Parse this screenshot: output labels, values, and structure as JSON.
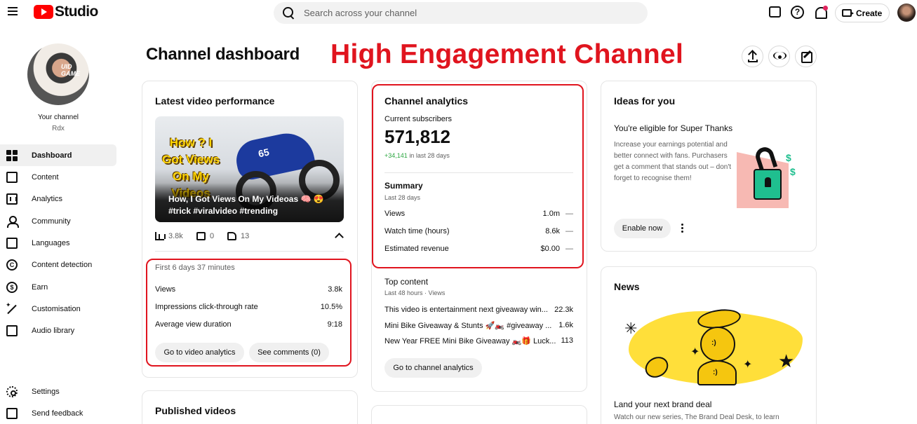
{
  "header": {
    "logo_text": "Studio",
    "search_placeholder": "Search across your channel",
    "create_label": "Create"
  },
  "annotation": {
    "text": "High Engagement Channel",
    "color": "#e0141e"
  },
  "sidebar": {
    "avatar_overlay": "UID GAME",
    "channel_label": "Your channel",
    "channel_name": "Rdx",
    "items": [
      {
        "label": "Dashboard",
        "icon": "dashboard-icon",
        "active": true
      },
      {
        "label": "Content",
        "icon": "content-icon"
      },
      {
        "label": "Analytics",
        "icon": "analytics-icon"
      },
      {
        "label": "Community",
        "icon": "community-icon"
      },
      {
        "label": "Languages",
        "icon": "languages-icon"
      },
      {
        "label": "Content detection",
        "icon": "copyright-icon"
      },
      {
        "label": "Earn",
        "icon": "dollar-icon"
      },
      {
        "label": "Customisation",
        "icon": "wand-icon"
      },
      {
        "label": "Audio library",
        "icon": "audio-library-icon"
      }
    ],
    "bottom": [
      {
        "label": "Settings",
        "icon": "gear-icon"
      },
      {
        "label": "Send feedback",
        "icon": "feedback-icon"
      }
    ]
  },
  "main": {
    "title": "Channel dashboard"
  },
  "latest_video": {
    "title": "Latest video performance",
    "thumbnail_overlay": "How ? I Got Views On My Videos",
    "bike_number": "65",
    "video_title": "How, I Got Views On My Videoas 🧠 😍 #trick #viralvideo #trending",
    "views": "3.8k",
    "comments": "0",
    "likes": "13",
    "period": "First 6 days 37 minutes",
    "metrics": [
      {
        "label": "Views",
        "value": "3.8k"
      },
      {
        "label": "Impressions click-through rate",
        "value": "10.5%"
      },
      {
        "label": "Average view duration",
        "value": "9:18"
      }
    ],
    "go_analytics_label": "Go to video analytics",
    "see_comments_label": "See comments (0)"
  },
  "published": {
    "title": "Published videos"
  },
  "analytics": {
    "title": "Channel analytics",
    "subs_label": "Current subscribers",
    "subs_value": "571,812",
    "subs_change": "+34,141",
    "subs_change_period": "in last 28 days",
    "summary_title": "Summary",
    "summary_period": "Last 28 days",
    "summary": [
      {
        "label": "Views",
        "value": "1.0m",
        "trend": "—"
      },
      {
        "label": "Watch time (hours)",
        "value": "8.6k",
        "trend": "—"
      },
      {
        "label": "Estimated revenue",
        "value": "$0.00",
        "trend": "—"
      }
    ],
    "top_content_title": "Top content",
    "top_content_period": "Last 48 hours · Views",
    "top_content": [
      {
        "title": "This video is entertainment next giveaway win...",
        "views": "22.3k"
      },
      {
        "title": "Mini Bike Giveaway & Stunts 🚀🏍️ #giveaway ...",
        "views": "1.6k"
      },
      {
        "title": "New Year FREE Mini Bike Giveaway 🏍️🎁 Luck...",
        "views": "113"
      }
    ],
    "go_channel_label": "Go to channel analytics"
  },
  "ideas": {
    "title": "Ideas for you",
    "headline": "You're eligible for Super Thanks",
    "body": "Increase your earnings potential and better connect with fans. Purchasers get a comment that stands out – don't forget to recognise them!",
    "enable_label": "Enable now"
  },
  "news": {
    "title": "News",
    "headline": "Land your next brand deal",
    "body": "Watch our new series, The Brand Deal Desk, to learn"
  }
}
